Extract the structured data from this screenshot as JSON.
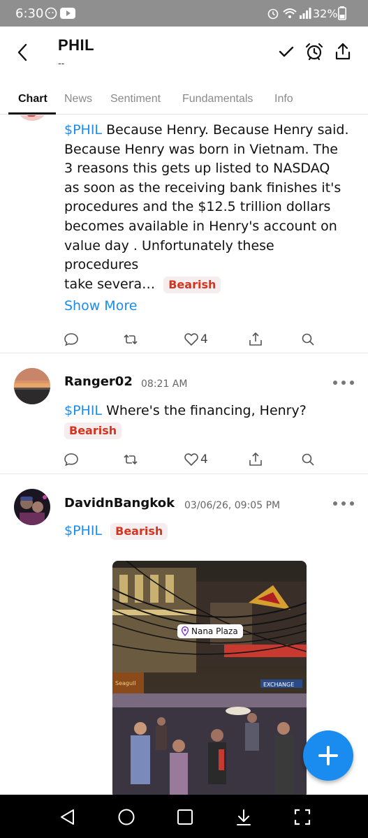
{
  "status_bar": {
    "time": "6:30",
    "battery": "32%"
  },
  "header": {
    "ticker": "PHIL",
    "subtitle": "--",
    "icons": [
      "check-icon",
      "alarm-icon",
      "share-icon"
    ]
  },
  "tabs": [
    {
      "label": "Chart",
      "active": true
    },
    {
      "label": "News",
      "active": false
    },
    {
      "label": "Sentiment",
      "active": false
    },
    {
      "label": "Fundamentals",
      "active": false
    },
    {
      "label": "Info",
      "active": false
    }
  ],
  "posts": [
    {
      "cashtag": "$PHIL",
      "lines": [
        " Because Henry. Because Henry said.",
        "Because Henry was born in Vietnam. The",
        "3 reasons this gets up listed to NASDAQ",
        "as soon as the receiving bank finishes it's",
        "procedures and the $12.5 trillion dollars",
        "becomes available in Henry's account on",
        "value day . Unfortunately these procedures",
        "take severa…"
      ],
      "sentiment": "Bearish",
      "show_more": "Show More",
      "likes": "4"
    },
    {
      "username": "Ranger02",
      "timestamp": "08:21 AM",
      "cashtag": "$PHIL",
      "text": " Where's the financing,  Henry?",
      "sentiment": "Bearish",
      "likes": "4"
    },
    {
      "username": "DavidnBangkok",
      "timestamp": "03/06/26, 09:05 PM",
      "cashtag": "$PHIL",
      "sentiment": "Bearish",
      "image_location": "Nana Plaza"
    }
  ],
  "colors": {
    "accent": "#1a8cf0",
    "bearish_text": "#d6341f",
    "bearish_bg": "#f6eeee"
  }
}
